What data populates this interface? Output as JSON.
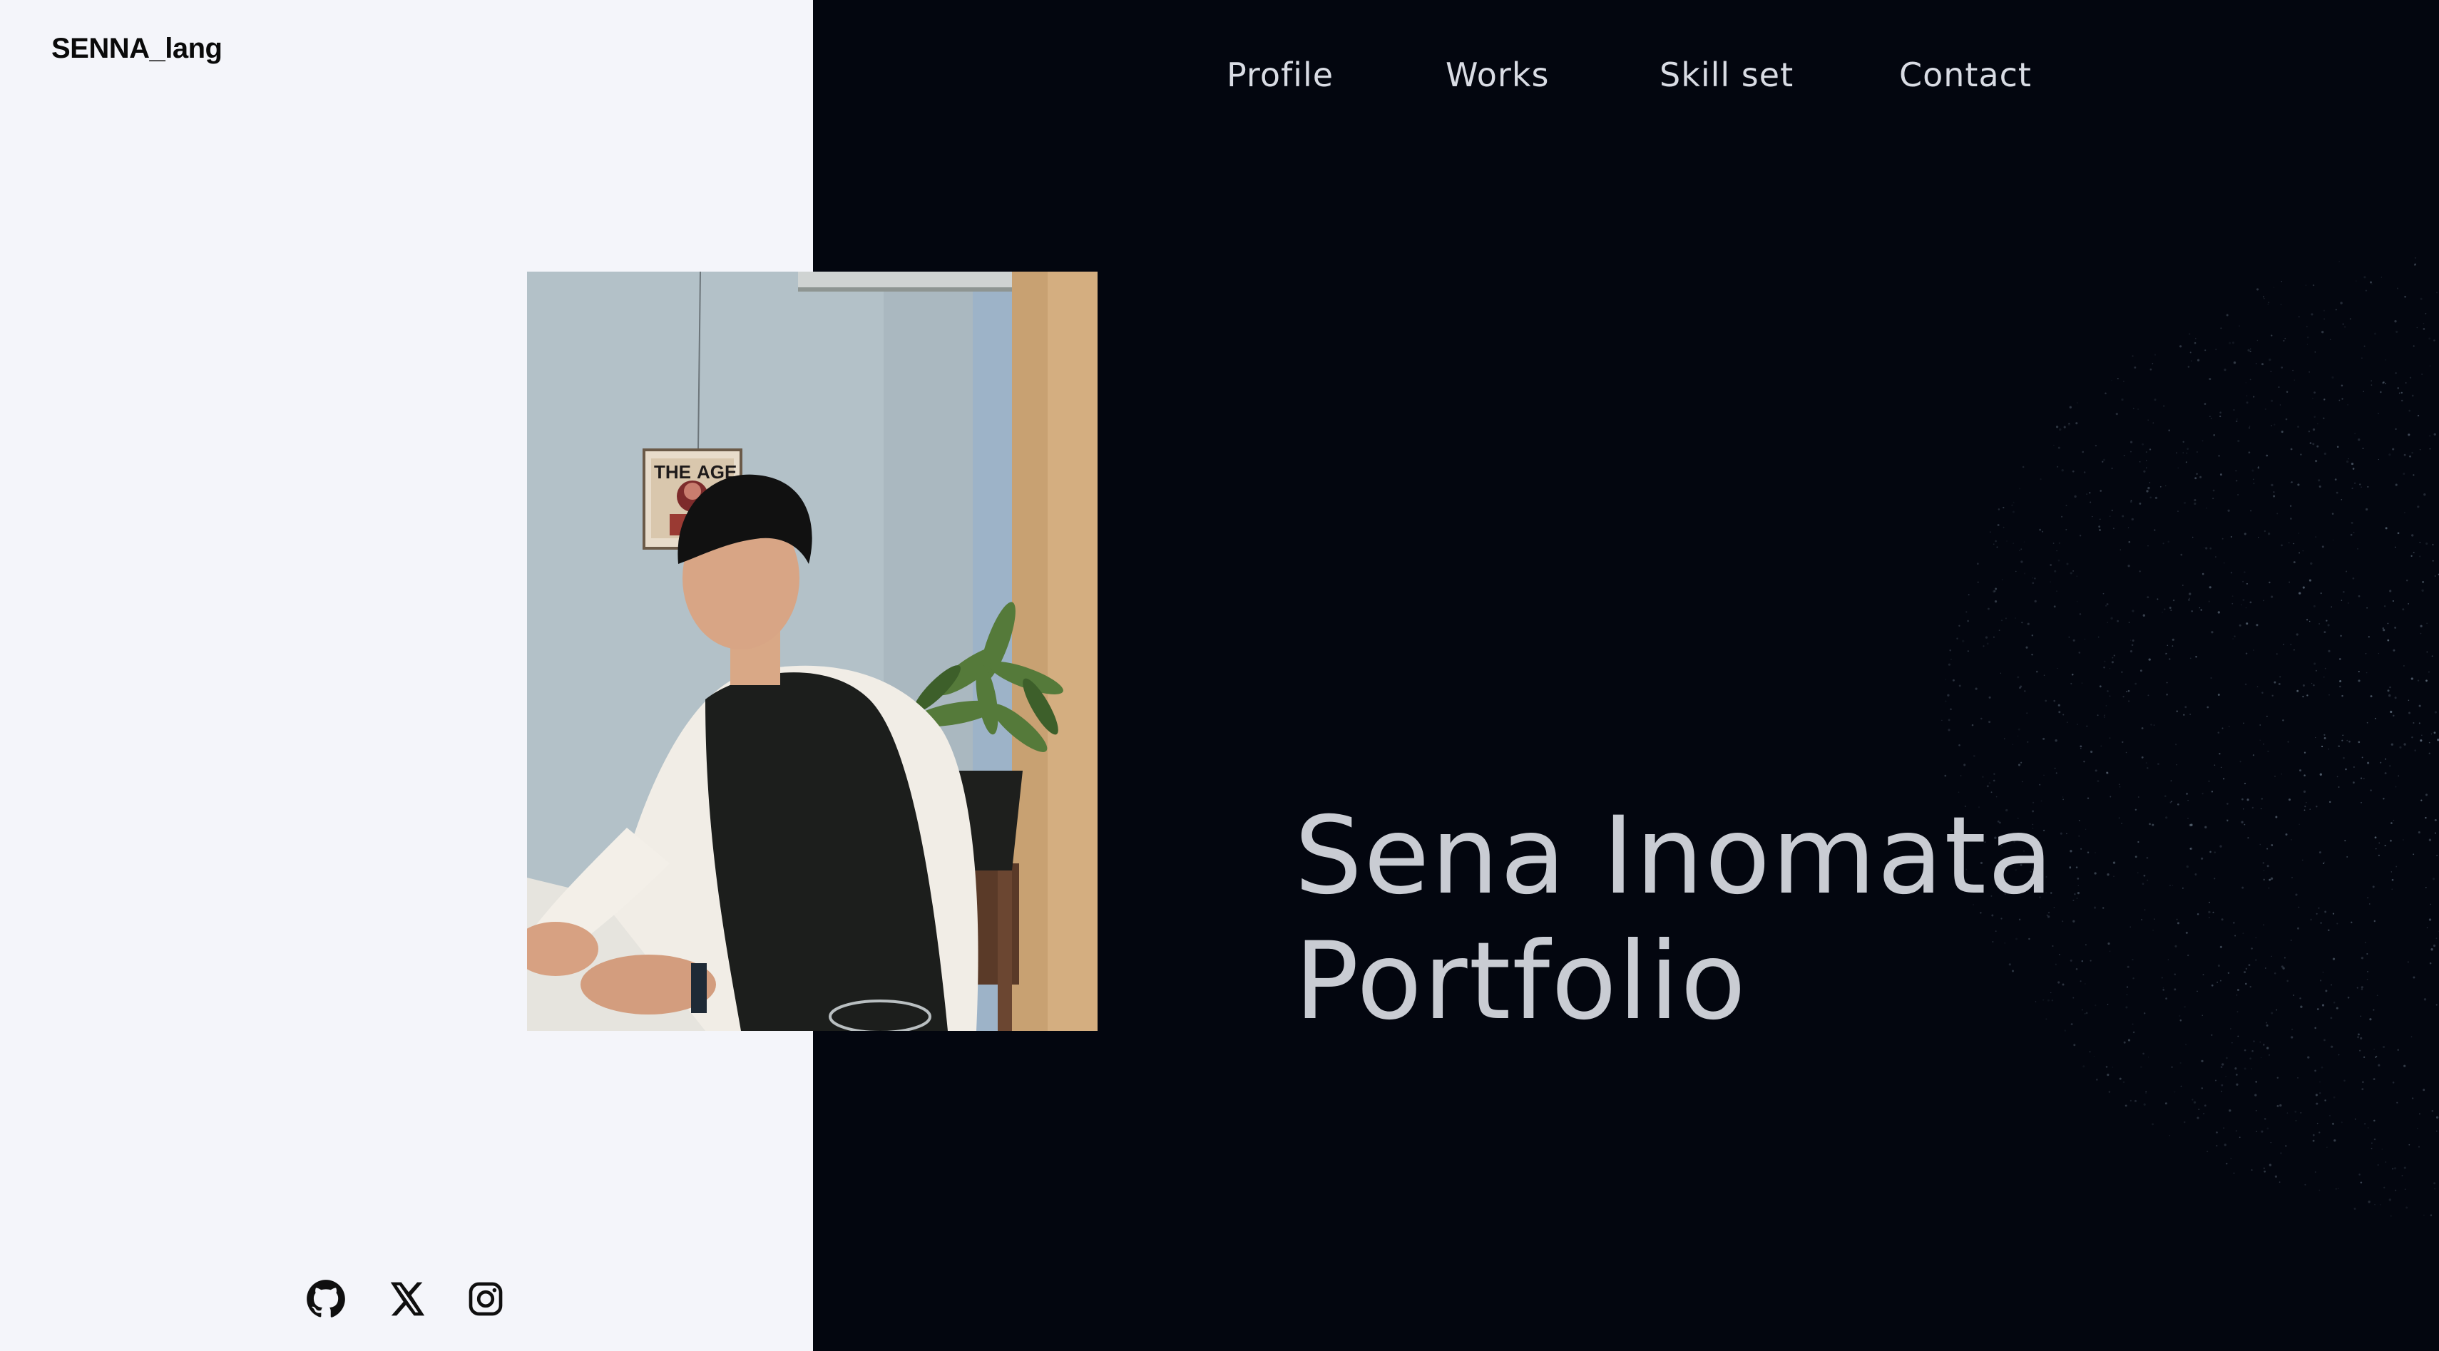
{
  "site": {
    "logo": "SENNA_lang"
  },
  "nav": {
    "items": [
      {
        "label": "Profile"
      },
      {
        "label": "Works"
      },
      {
        "label": "Skill set"
      },
      {
        "label": "Contact"
      }
    ]
  },
  "hero": {
    "title_line1": "Sena Inomata",
    "title_line2": "Portfolio"
  },
  "social": {
    "icons": [
      "github-icon",
      "x-icon",
      "instagram-icon"
    ]
  },
  "colors": {
    "left_background": "#f4f5fa",
    "right_background": "#03060f",
    "hero_text": "#c9ccd3",
    "nav_text": "#d9dce4"
  }
}
